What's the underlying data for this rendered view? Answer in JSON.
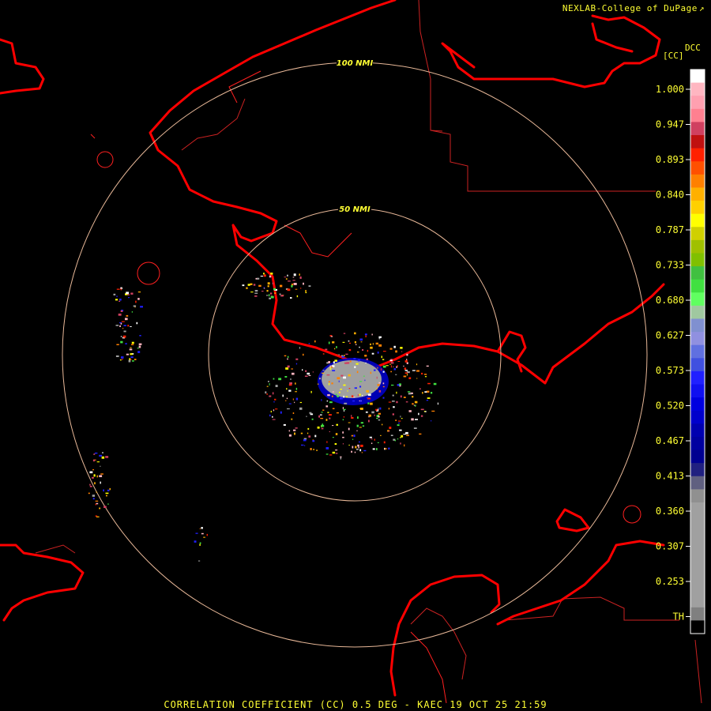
{
  "credit": "NEXLAB-College of DuPage",
  "credit_icon": "external-link-icon",
  "legend": {
    "title": "DCC",
    "subtitle": "[CC]",
    "labels": [
      "1.000",
      "0.947",
      "0.893",
      "0.840",
      "0.787",
      "0.733",
      "0.680",
      "0.627",
      "0.573",
      "0.520",
      "0.467",
      "0.413",
      "0.360",
      "0.307",
      "0.253",
      "TH"
    ],
    "colors": [
      "#ffffff",
      "#ffb6c1",
      "#ffa0b0",
      "#ff8090",
      "#d04060",
      "#c01010",
      "#ff2000",
      "#ff5000",
      "#ff8000",
      "#ffb000",
      "#ffd000",
      "#ffff00",
      "#d0d000",
      "#a0c000",
      "#80c000",
      "#40c040",
      "#40e040",
      "#60ff60",
      "#a0c8a0",
      "#8090d0",
      "#9090e0",
      "#6070e0",
      "#4050e0",
      "#2020ff",
      "#1010f0",
      "#0000e0",
      "#0000cc",
      "#0000b0",
      "#0000a0",
      "#000090",
      "#202080",
      "#606080",
      "#909090",
      "#a0a0a0",
      "#a0a0a0",
      "#a0a0a0",
      "#a0a0a0",
      "#a0a0a0",
      "#a0a0a0",
      "#a0a0a0",
      "#a0a0a0",
      "#808080",
      "#000000"
    ]
  },
  "range_rings": [
    {
      "label": "100 NMI",
      "nmi": 100
    },
    {
      "label": "50 NMI",
      "nmi": 50
    }
  ],
  "footer": "CORRELATION COEFFICIENT (CC) 0.5 DEG - KAEC 19 OCT 25 21:59",
  "colors": {
    "text": "#ffff33",
    "coastline": "#ff0000",
    "ring": "#e8b898",
    "border": "#cc2222",
    "background": "#000000"
  }
}
